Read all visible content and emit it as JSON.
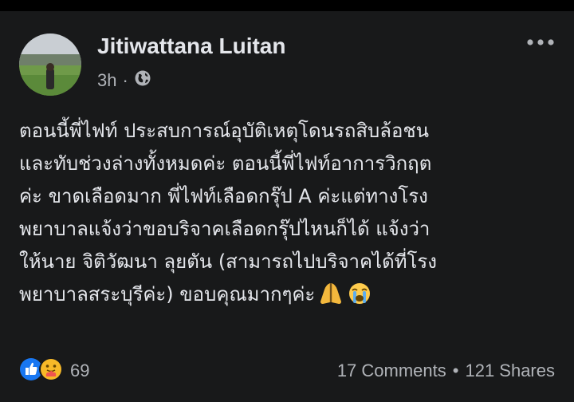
{
  "post": {
    "author": "Jitiwattana Luitan",
    "time": "3h",
    "separator": "·",
    "privacy_icon": "globe-icon",
    "menu_icon": "more-icon",
    "lines": [
      "ตอนนี้พี่ไฟท์ ประสบการณ์อุบัติเหตุโดนรถสิบล้อชน",
      "และทับช่วงล่างทั้งหมดค่ะ ตอนนี้พี่ไฟท์อาการวิกฤต",
      "ค่ะ ขาดเลือดมาก พี่ไฟท์เลือดกรุ๊ป  A ค่ะแต่ทางโรง",
      "พยาบาลแจ้งว่าขอบริจาคเลือดกรุ๊ปไหนก็ได้ แจ้งว่า",
      "ให้นาย จิติวัฒนา ลุยตัน (สามารถไปบริจาคได้ที่โรง",
      "พยาบาลสระบุรีค่ะ) ขอบคุณมากๆค่ะ"
    ],
    "emojis": [
      "folded-hands-emoji",
      "crying-face-emoji"
    ]
  },
  "footer": {
    "reaction_icons": [
      "like-icon",
      "care-icon"
    ],
    "reaction_count": "69",
    "comments": "17 Comments",
    "bullet": "•",
    "shares": "121 Shares"
  },
  "colors": {
    "background": "#18191a",
    "text_primary": "#e4e6eb",
    "text_secondary": "#b0b3b8",
    "like_blue": "#1877f2",
    "care_yellow": "#f7b928"
  }
}
